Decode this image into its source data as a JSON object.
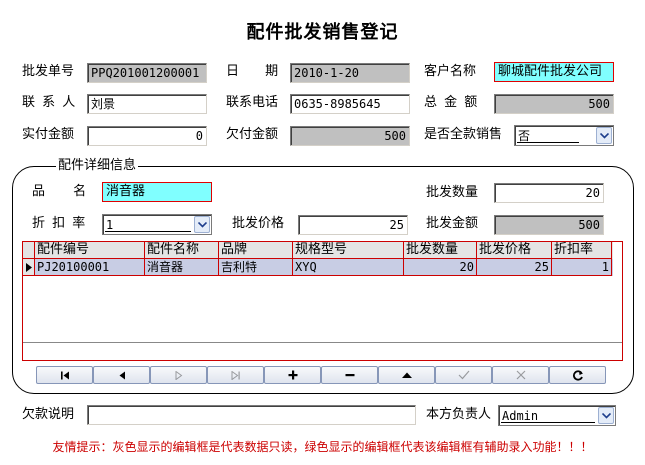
{
  "title": "配件批发销售登记",
  "header": {
    "order_no": {
      "label": "批发单号",
      "value": "PPQ201001200001"
    },
    "date": {
      "label": "日 期",
      "value": "2010-1-20"
    },
    "customer": {
      "label": "客户名称",
      "value": "聊城配件批发公司"
    },
    "contact": {
      "label": "联 系 人",
      "value": "刘景"
    },
    "phone": {
      "label": "联系电话",
      "value": "0635-8985645"
    },
    "total": {
      "label": "总 金 额",
      "value": "500"
    },
    "paid": {
      "label": "实付金额",
      "value": "0"
    },
    "owed": {
      "label": "欠付金额",
      "value": "500"
    },
    "full_pay": {
      "label": "是否全款销售",
      "value": "否"
    }
  },
  "detail": {
    "group_title": "配件详细信息",
    "product": {
      "label": "品 名",
      "value": "消音器"
    },
    "qty": {
      "label": "批发数量",
      "value": "20"
    },
    "discount": {
      "label": "折 扣 率",
      "value": "1"
    },
    "price": {
      "label": "批发价格",
      "value": "25"
    },
    "amount": {
      "label": "批发金额",
      "value": "500"
    }
  },
  "grid": {
    "columns": [
      "配件编号",
      "配件名称",
      "品牌",
      "规格型号",
      "批发数量",
      "批发价格",
      "折扣率"
    ],
    "rows": [
      [
        "PJ20100001",
        "消音器",
        "吉利特",
        "XYQ",
        "20",
        "25",
        "1"
      ]
    ]
  },
  "nav_buttons": [
    "first-icon",
    "prev-icon",
    "next-icon",
    "last-icon",
    "add-icon",
    "delete-icon",
    "edit-icon",
    "post-icon",
    "cancel-icon",
    "refresh-icon"
  ],
  "footer": {
    "debt_note": {
      "label": "欠款说明",
      "value": ""
    },
    "owner": {
      "label": "本方负责人",
      "value": "Admin"
    }
  },
  "hint": "友情提示：灰色显示的编辑框是代表数据只读，绿色显示的编辑框代表该编辑框有辅助录入功能！！！"
}
